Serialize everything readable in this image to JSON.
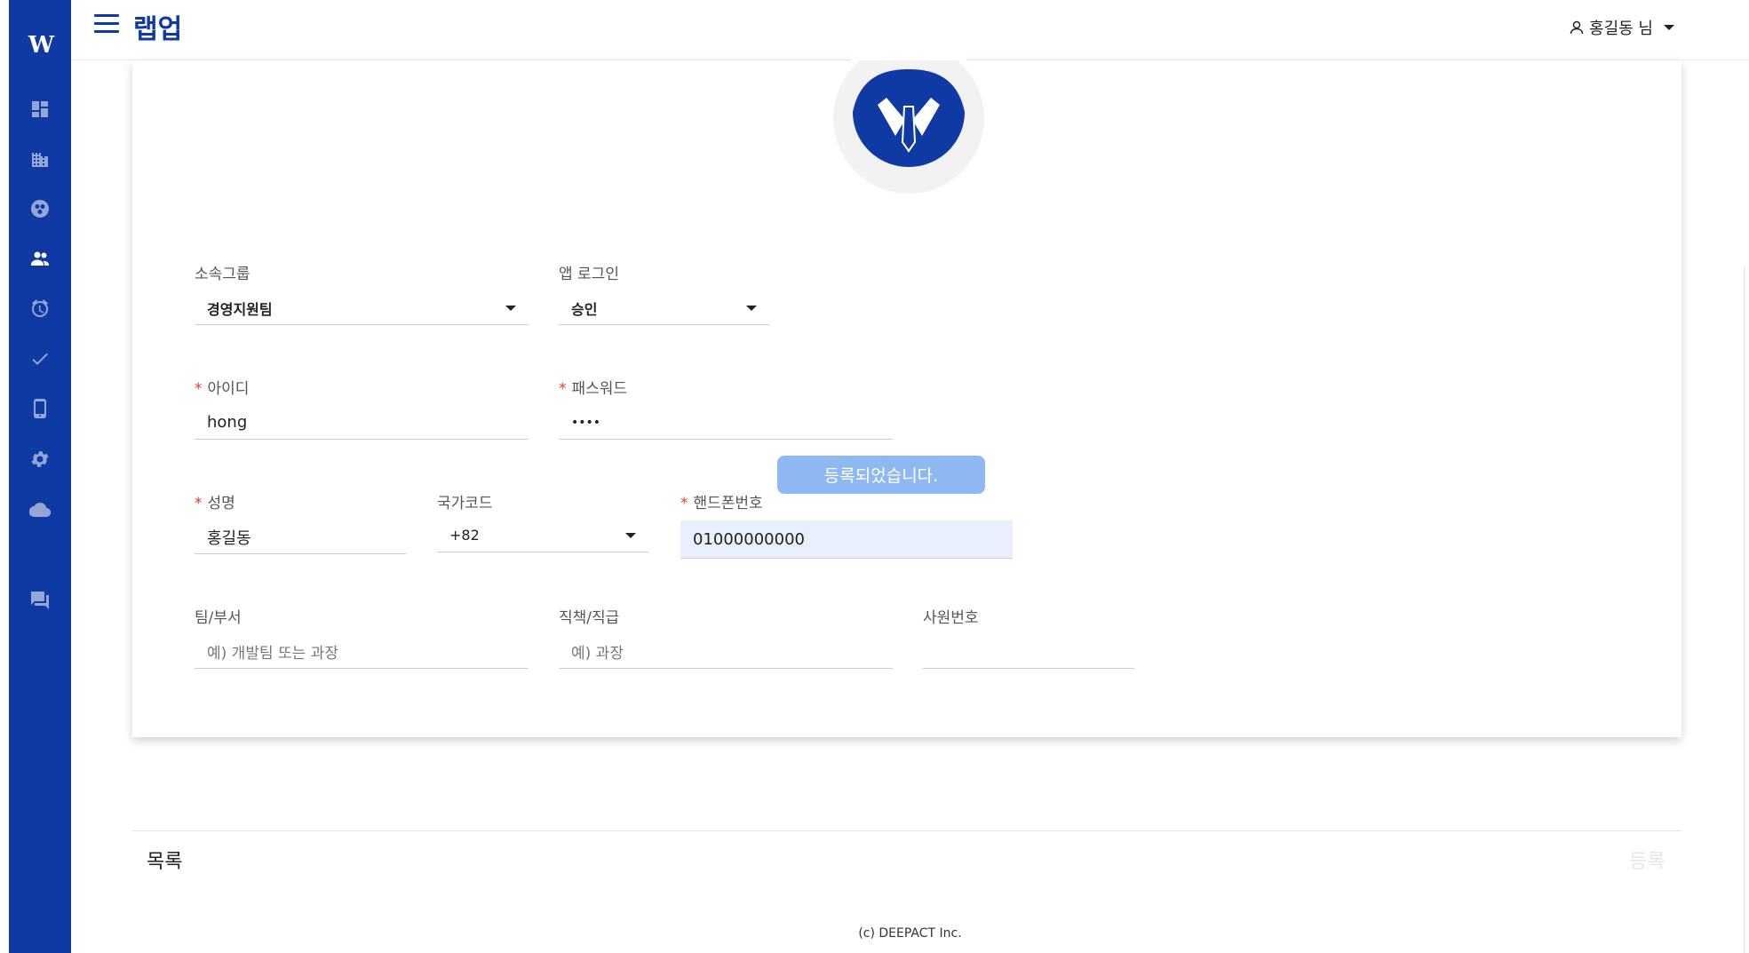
{
  "app": {
    "title": "랩업"
  },
  "user": {
    "name": "홍길동 님"
  },
  "sidebar": {
    "logo": "W",
    "items": [
      {
        "icon": "dashboard-icon"
      },
      {
        "icon": "building-icon"
      },
      {
        "icon": "group-icon"
      },
      {
        "icon": "users-icon"
      },
      {
        "icon": "alarm-clock-icon"
      },
      {
        "icon": "checkmark-icon"
      },
      {
        "icon": "mobile-phone-icon"
      },
      {
        "icon": "gear-icon"
      },
      {
        "icon": "cloud-icon"
      },
      {
        "icon": "chat-icon"
      }
    ]
  },
  "form": {
    "group": {
      "label": "소속그룹",
      "value": "경영지원팀"
    },
    "app_login": {
      "label": "앱 로그인",
      "value": "승인"
    },
    "user_id": {
      "label": "아이디",
      "value": "hong"
    },
    "password": {
      "label": "패스워드",
      "value": "••••"
    },
    "name": {
      "label": "성명",
      "value": "홍길동"
    },
    "country_code": {
      "label": "국가코드",
      "value": "+82"
    },
    "phone": {
      "label": "핸드폰번호",
      "value": "01000000000"
    },
    "team": {
      "label": "팀/부서",
      "placeholder": "예) 개발팀 또는 과장"
    },
    "position": {
      "label": "직책/직급",
      "placeholder": "예) 과장"
    },
    "employee_no": {
      "label": "사원번호",
      "value": ""
    }
  },
  "toast": {
    "message": "등록되었습니다."
  },
  "actions": {
    "list_label": "목록",
    "register_label": "등록"
  },
  "footer": {
    "copyright": "(c) DEEPACT Inc."
  },
  "colors": {
    "primary": "#0f3aa3",
    "toast": "#8db8f2",
    "required": "#e53935"
  }
}
